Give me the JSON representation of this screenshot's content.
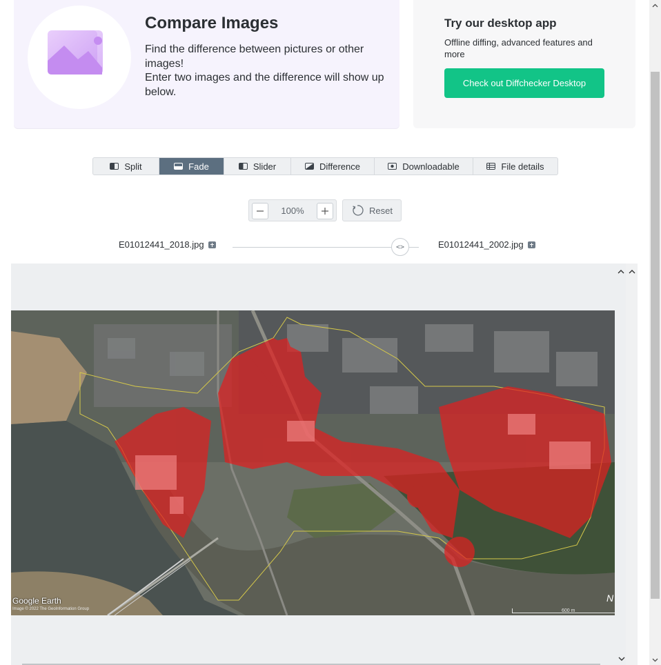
{
  "hero": {
    "title": "Compare Images",
    "description": "Find the difference between pictures or other images!",
    "instruction": "Enter two images and the difference will show up below."
  },
  "promo": {
    "title": "Try our desktop app",
    "description": "Offline diffing, advanced features and more",
    "button_label": "Check out Diffchecker Desktop"
  },
  "view_tabs": [
    {
      "label": "Split",
      "icon": "split-icon",
      "active": false
    },
    {
      "label": "Fade",
      "icon": "fade-icon",
      "active": true
    },
    {
      "label": "Slider",
      "icon": "slider-icon",
      "active": false
    },
    {
      "label": "Difference",
      "icon": "difference-icon",
      "active": false
    },
    {
      "label": "Downloadable",
      "icon": "download-icon",
      "active": false
    },
    {
      "label": "File details",
      "icon": "file-details-icon",
      "active": false
    }
  ],
  "zoom": {
    "value": "100%",
    "reset_label": "Reset"
  },
  "fade": {
    "left_file": "E01012441_2018.jpg",
    "right_file": "E01012441_2002.jpg",
    "position": 0.9,
    "thumb_glyph": "<>"
  },
  "map": {
    "watermark": "Google Earth",
    "credit": "Image © 2022 The GeoInformation Group",
    "scale": "600 m"
  },
  "colors": {
    "accent": "#12c487",
    "active_tab": "#5c6f80",
    "hero_bg": "#f6f3fd",
    "diff_overlay": "#e02020"
  }
}
